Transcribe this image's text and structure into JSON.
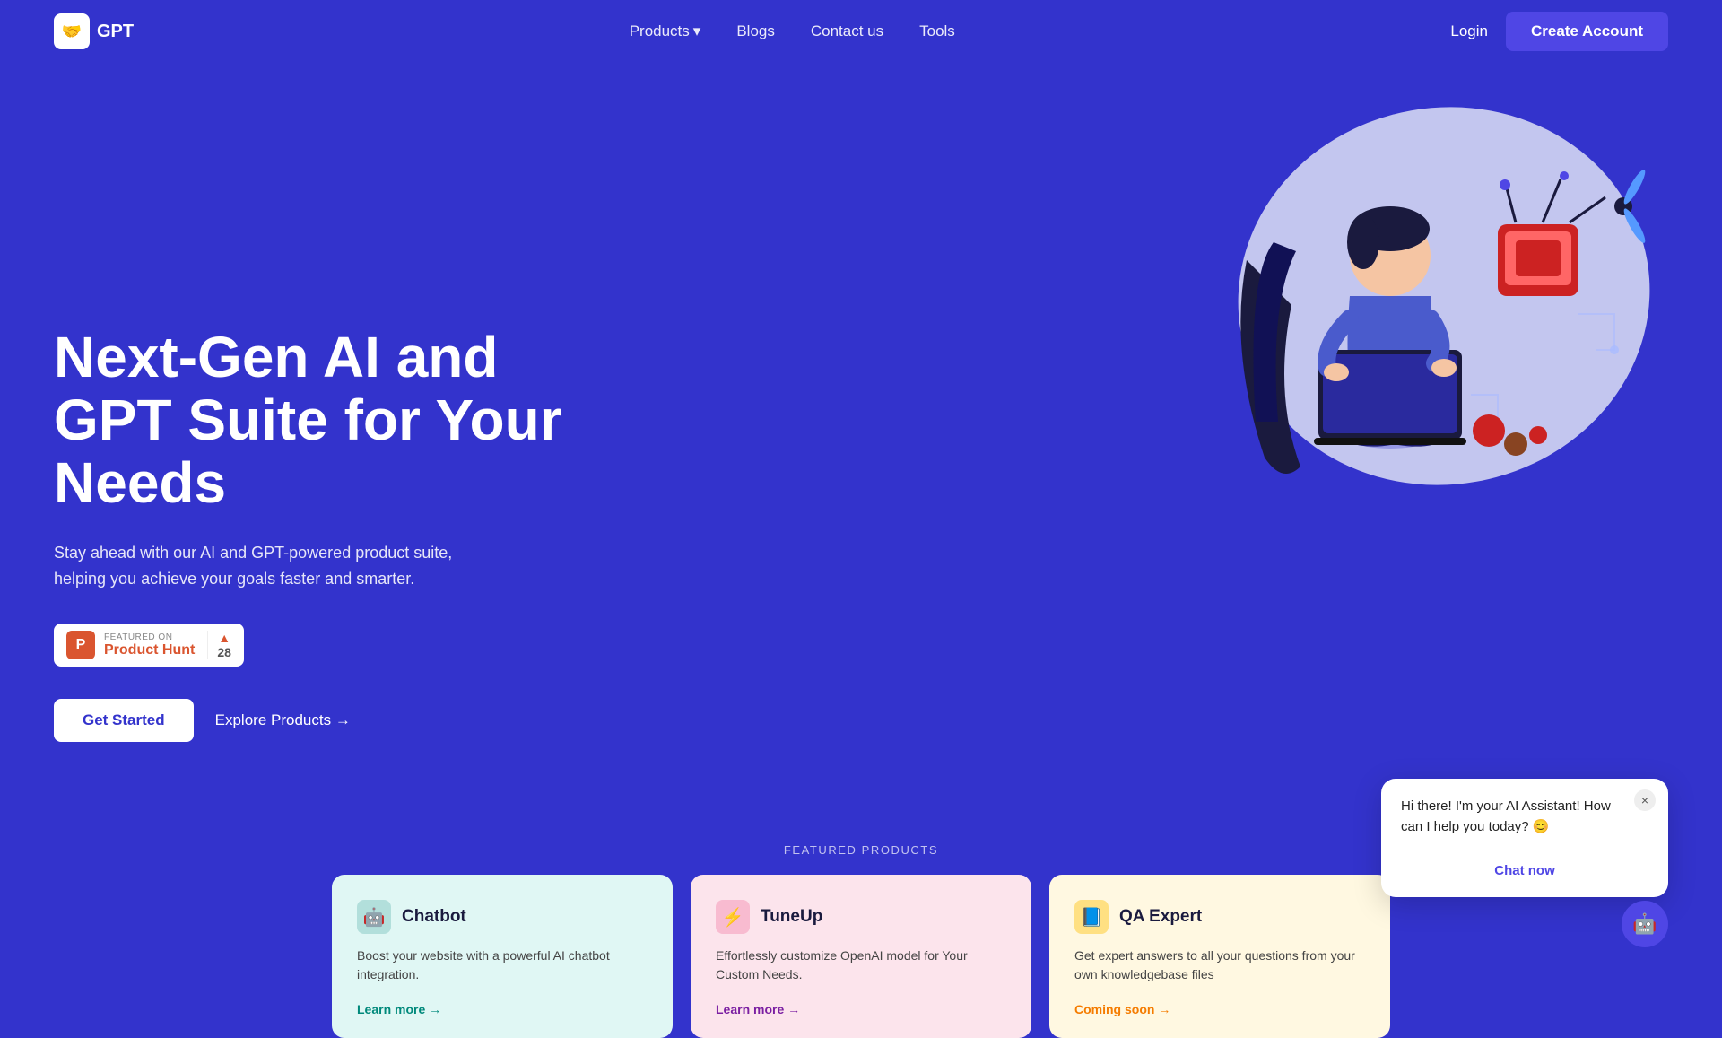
{
  "nav": {
    "logo_text": "GPT",
    "logo_emoji": "🤝",
    "links": [
      {
        "label": "Products",
        "has_dropdown": true
      },
      {
        "label": "Blogs"
      },
      {
        "label": "Contact us"
      },
      {
        "label": "Tools"
      }
    ],
    "login_label": "Login",
    "create_account_label": "Create Account"
  },
  "hero": {
    "title": "Next-Gen AI and GPT Suite for Your Needs",
    "subtitle": "Stay ahead with our AI and GPT-powered product suite, helping you achieve your goals faster and smarter.",
    "product_hunt": {
      "featured_on": "FEATURED ON",
      "name": "Product Hunt",
      "count": "28"
    },
    "get_started": "Get Started",
    "explore_products": "Explore Products →"
  },
  "featured": {
    "label": "FEATURED PRODUCTS",
    "products": [
      {
        "name": "Chatbot",
        "desc": "Boost your website with a powerful AI chatbot integration.",
        "link": "Learn more →",
        "icon": "🤖",
        "style": "cyan"
      },
      {
        "name": "TuneUp",
        "desc": "Effortlessly customize OpenAI model for Your Custom Needs.",
        "link": "Learn more →",
        "icon": "⚡",
        "style": "pink"
      },
      {
        "name": "QA Expert",
        "desc": "Get expert answers to all your questions from your own knowledgebase files",
        "link": "Coming soon →",
        "icon": "📘",
        "style": "yellow"
      }
    ]
  },
  "chat_widget": {
    "message": "Hi there! I'm your AI Assistant! How can I help you today? 😊",
    "cta": "Chat now",
    "close_label": "×"
  }
}
